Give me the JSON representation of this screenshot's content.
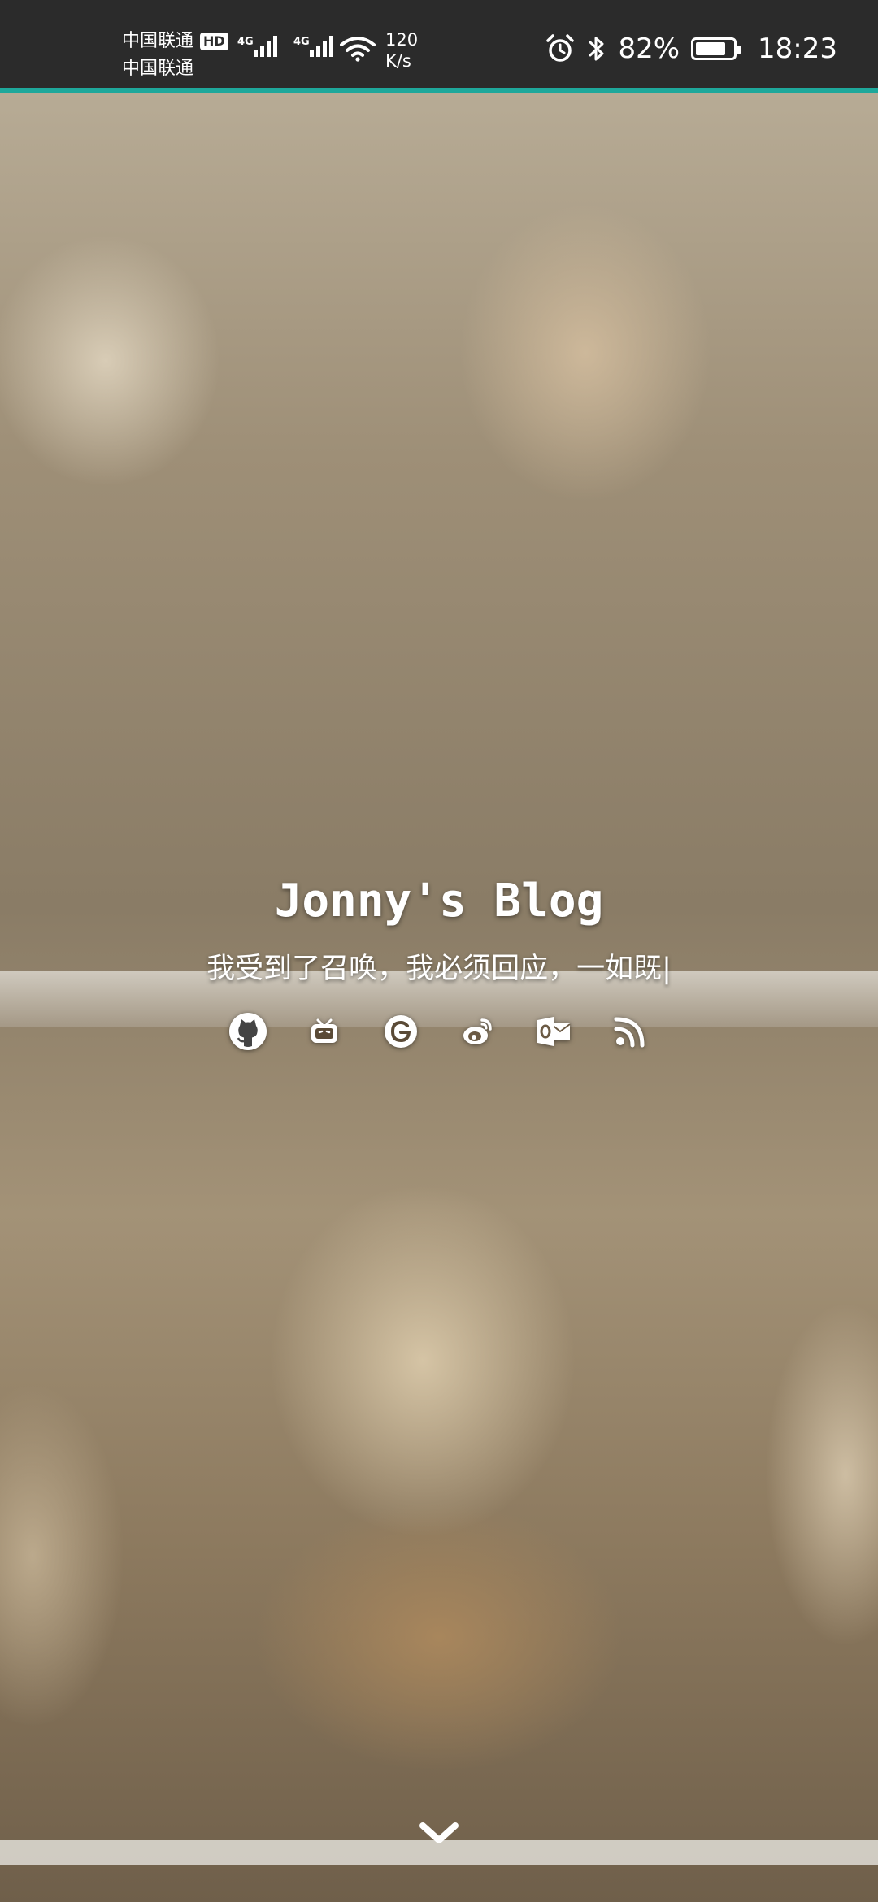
{
  "status_bar": {
    "carrier_primary": "中国联通",
    "carrier_secondary": "中国联通",
    "hd_badge": "HD",
    "signal_1_generation": "4G",
    "signal_2_generation": "4G",
    "net_speed_value": "120",
    "net_speed_unit": "K/s",
    "battery_percent": "82%",
    "battery_level": 0.82,
    "time": "18:23"
  },
  "hero": {
    "title": "Jonny's Blog",
    "subtitle": "我受到了召唤，我必须回应，一如既|"
  },
  "social": {
    "icons": [
      "github-icon",
      "bilibili-icon",
      "google-icon",
      "weibo-icon",
      "outlook-icon",
      "rss-icon"
    ]
  },
  "colors": {
    "accent": "#1ea89b",
    "status_bar_bg": "#2b2b2b"
  }
}
